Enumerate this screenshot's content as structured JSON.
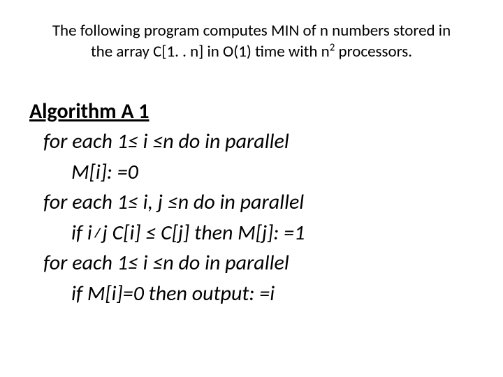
{
  "header": {
    "line1": "The following program computes MIN of n numbers stored in",
    "line2_a": "the array C[1. . n] in O(1) time with n",
    "line2_sup": "2",
    "line2_b": " processors."
  },
  "algo": {
    "title": "Algorithm A 1",
    "l1a": "for each 1",
    "leq": "≤",
    "l1b": " i ",
    "l1c": "n do in parallel",
    "l2": "M[i]: =0",
    "l3a": "for each 1",
    "l3b": " i, j ",
    "l3c": "n do in parallel",
    "l4a": "if i",
    "neq": "≠",
    "l4b": "j C[i] ",
    "l4c": " C[j] then M[j]: =1",
    "l5a": "for each 1",
    "l5b": " i ",
    "l5c": "n do in parallel",
    "l6": "if M[i]=0 then output: =i"
  }
}
